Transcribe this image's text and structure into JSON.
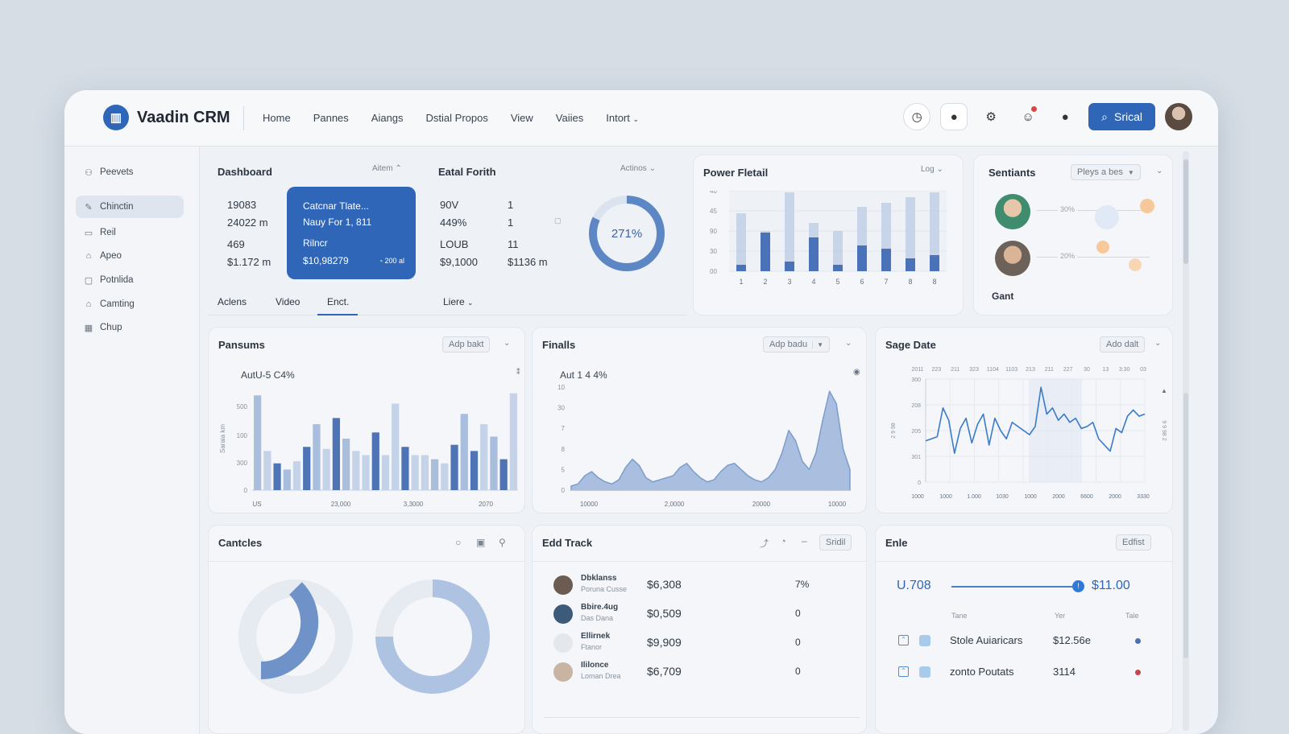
{
  "app": {
    "name": "Vaadin CRM"
  },
  "nav": [
    "Home",
    "Pannes",
    "Aiangs",
    "Dstial Propos",
    "View",
    "Vaiies",
    "Intort"
  ],
  "search_label": "Srical",
  "sidebar": {
    "items": [
      "Peevets",
      "Chinctin",
      "Reil",
      "Apeo",
      "Potnlida",
      "Camting",
      "Chup"
    ]
  },
  "dashboard": {
    "title": "Dashboard",
    "control": "Aitem",
    "stats": [
      "19083",
      "24022 m",
      "469",
      "$1.172 m"
    ],
    "highlight": {
      "line1": "Catcnar Tlate...",
      "line2": "Nauy For 1, 811",
      "line3": "Rilncr",
      "value": "$10,98279",
      "badge": "200 al"
    },
    "tabs": [
      "Aclens",
      "Video",
      "Enct.",
      "Liere"
    ]
  },
  "eatal": {
    "title": "Eatal Forith",
    "control": "Actinos",
    "rows": [
      [
        "90V",
        "1"
      ],
      [
        "449%",
        "1"
      ],
      [
        "LOUB",
        "11"
      ],
      [
        "$9,1000",
        "$1136 m"
      ]
    ],
    "donut_label": "271%",
    "donut_fraction": 0.82
  },
  "power": {
    "title": "Power Fletail",
    "control": "Log"
  },
  "sentiants": {
    "title": "Sentiants",
    "select": "Pleys a bes",
    "pcts": [
      "30%",
      "20%"
    ],
    "footer": "Gant"
  },
  "pansums": {
    "title": "Pansums",
    "control": "Adp bakt",
    "subtitle": "AutU-5 C4%"
  },
  "finalls": {
    "title": "Finalls",
    "control": "Adp badu",
    "subtitle": "Aut 1 4 4%"
  },
  "sage": {
    "title": "Sage Date",
    "control": "Ado dalt"
  },
  "cantcles": {
    "title": "Cantcles"
  },
  "edd": {
    "title": "Edd Track",
    "button": "Sridil",
    "rows": [
      {
        "name": "Dbklanss",
        "sub": "Poruna Cusse",
        "amount": "$6,308",
        "val": "7%"
      },
      {
        "name": "Bbire.4ug",
        "sub": "Das Dana",
        "amount": "$0,509",
        "val": "0"
      },
      {
        "name": "Ellirnek",
        "sub": "Ftanor",
        "amount": "$9,909",
        "val": "0"
      },
      {
        "name": "Ililonce",
        "sub": "Loman Drea",
        "amount": "$6,709",
        "val": "0"
      }
    ]
  },
  "enle": {
    "title": "Enle",
    "button": "Edfist",
    "left_val": "U.708",
    "right_val": "$11.00",
    "cols": [
      "Tane",
      "Yer",
      "Tale"
    ],
    "rows": [
      {
        "name": "Stole Auiaricars",
        "value": "$12.56e",
        "color": "#4a6fb5"
      },
      {
        "name": "zonto Poutats",
        "value": "3114",
        "color": "#c0474d"
      }
    ]
  },
  "colors": {
    "accent": "#2f66b8",
    "bar_dark": "#4a72b8",
    "bar_light": "#b8c9e3"
  },
  "chart_data": [
    {
      "type": "bar",
      "id": "power",
      "y_ticks": [
        "40",
        "45",
        "90",
        "30",
        "00"
      ],
      "categories": [
        "1",
        "2",
        "3",
        "4",
        "5",
        "6",
        "7",
        "8",
        "8"
      ],
      "series": [
        {
          "values": [
            8,
            48,
            12,
            42,
            8,
            32,
            28,
            16,
            20
          ]
        },
        {
          "values": [
            72,
            50,
            98,
            60,
            50,
            80,
            85,
            92,
            98
          ]
        }
      ]
    },
    {
      "type": "bar",
      "id": "pansums",
      "ylabel": "Saraia km",
      "y_ticks": [
        "0",
        "300",
        "100",
        "500"
      ],
      "x_ticks": [
        "US",
        "23,000",
        "3,3000",
        "2070"
      ],
      "values": [
        92,
        38,
        26,
        20,
        28,
        42,
        64,
        40,
        70,
        50,
        38,
        34,
        56,
        34,
        84,
        42,
        34,
        34,
        30,
        26,
        44,
        74,
        38,
        64,
        52,
        30,
        94
      ]
    },
    {
      "type": "area",
      "id": "finalls",
      "y_ticks": [
        "0",
        "5",
        "8",
        "7",
        "30",
        "10"
      ],
      "x_ticks": [
        "10000",
        "2,0000",
        "20000",
        "10000"
      ],
      "values": [
        4,
        6,
        14,
        18,
        12,
        8,
        6,
        10,
        22,
        30,
        24,
        12,
        8,
        10,
        12,
        14,
        22,
        26,
        18,
        12,
        8,
        10,
        18,
        24,
        26,
        20,
        14,
        10,
        8,
        12,
        20,
        36,
        58,
        48,
        28,
        20,
        36,
        68,
        96,
        84,
        40,
        20
      ]
    },
    {
      "type": "line",
      "id": "sage",
      "y_ticks": [
        "0",
        "301",
        "205",
        "208",
        "300"
      ],
      "x_ticks": [
        "1000",
        "1000",
        "1.000",
        "1030",
        "1000",
        "2000",
        "6600",
        "2000",
        "3330"
      ],
      "top_ticks": [
        "2011",
        "223",
        "211",
        "323",
        "1104",
        "1103",
        "213",
        "211",
        "227",
        "30",
        "13",
        "3:30",
        "03"
      ],
      "values": [
        40,
        42,
        44,
        72,
        60,
        28,
        52,
        62,
        38,
        56,
        66,
        36,
        62,
        50,
        42,
        58,
        54,
        50,
        46,
        54,
        92,
        66,
        72,
        60,
        66,
        58,
        62,
        52,
        54,
        58,
        42,
        36,
        30,
        52,
        48,
        64,
        70,
        64,
        66
      ]
    }
  ]
}
